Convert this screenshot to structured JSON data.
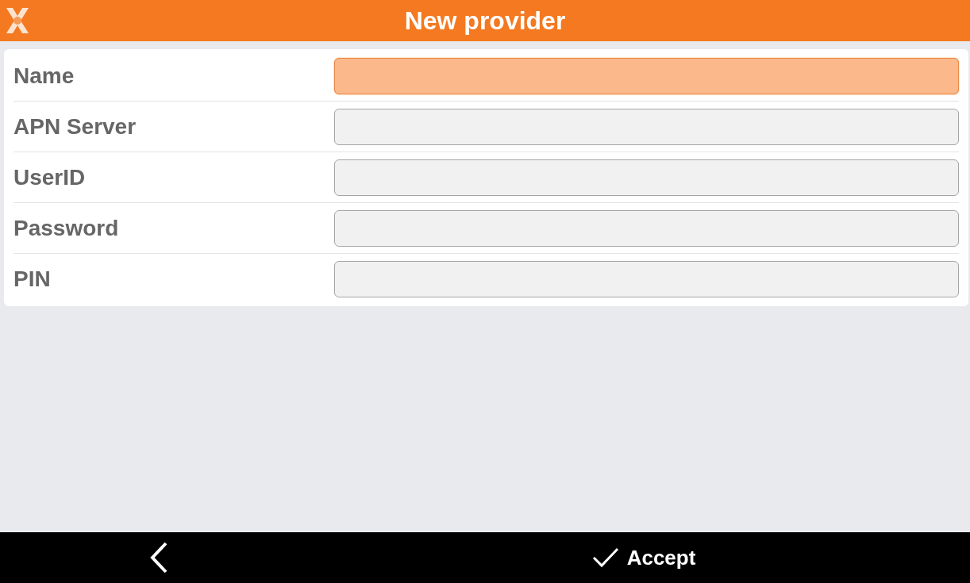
{
  "window": {
    "title": "New provider"
  },
  "fields": [
    {
      "label": "Name",
      "focused": true
    },
    {
      "label": "APN Server",
      "focused": false
    },
    {
      "label": "UserID",
      "focused": false
    },
    {
      "label": "Password",
      "focused": false
    },
    {
      "label": "PIN",
      "focused": false
    }
  ],
  "footer": {
    "accept": "Accept"
  }
}
